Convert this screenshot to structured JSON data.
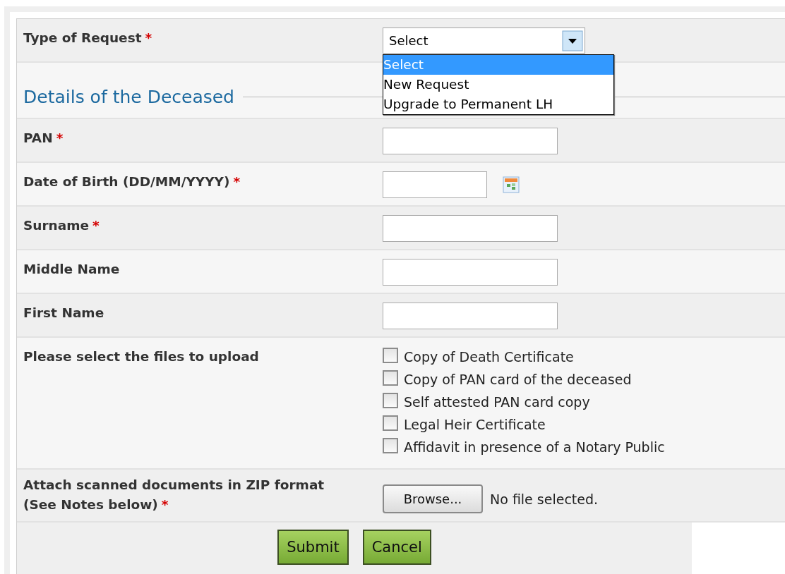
{
  "request_type": {
    "label": "Type of Request",
    "required_mark": "*",
    "value": "Select",
    "expanded": true,
    "options": [
      {
        "label": "Select",
        "selected": true
      },
      {
        "label": "New Request",
        "selected": false
      },
      {
        "label": "Upgrade to Permanent LH",
        "selected": false
      }
    ]
  },
  "section_title": "Details of the Deceased",
  "fields": [
    {
      "label": "PAN",
      "required_mark": "*",
      "kind": "text"
    },
    {
      "label": "Date of Birth (DD/MM/YYYY)",
      "required_mark": "*",
      "kind": "date"
    },
    {
      "label": "Surname",
      "required_mark": "*",
      "kind": "text"
    },
    {
      "label": "Middle Name",
      "kind": "text"
    },
    {
      "label": "First Name",
      "kind": "text"
    }
  ],
  "uploads": {
    "label": "Please select the files to upload",
    "files": [
      {
        "label": "Copy of Death Certificate",
        "checked": false
      },
      {
        "label": "Copy of PAN card of the deceased",
        "checked": false
      },
      {
        "label": "Self attested PAN card copy",
        "checked": false
      },
      {
        "label": "Legal Heir Certificate",
        "checked": false
      },
      {
        "label": "Affidavit in presence of a Notary Public",
        "checked": false
      }
    ]
  },
  "attachment": {
    "label_lines": [
      "Attach scanned documents in ZIP format",
      "(See Notes below)"
    ],
    "required_mark": "*",
    "button": "Browse...",
    "status": "No file selected."
  },
  "buttons": [
    "Submit",
    "Cancel"
  ]
}
